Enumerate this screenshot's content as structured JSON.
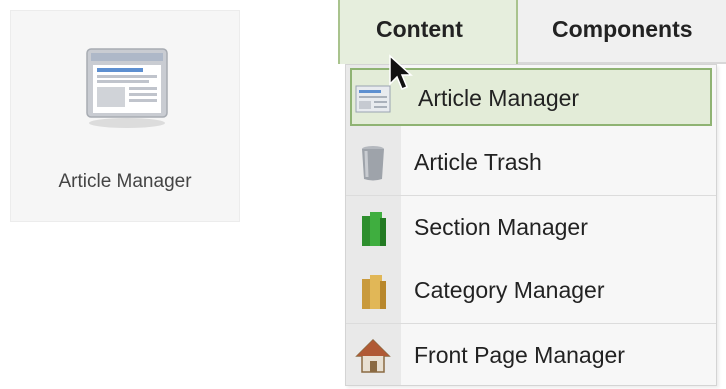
{
  "quick_icon": {
    "label": "Article Manager",
    "icon": "article-manager-icon"
  },
  "menubar": {
    "tabs": [
      {
        "label": "Content",
        "active": true
      },
      {
        "label": "Components",
        "active": false
      }
    ]
  },
  "dropdown": {
    "items": [
      {
        "label": "Article Manager",
        "icon": "article-manager-icon",
        "highlighted": true
      },
      {
        "label": "Article Trash",
        "icon": "trash-can-icon"
      },
      {
        "label": "Section Manager",
        "icon": "section-books-icon"
      },
      {
        "label": "Category Manager",
        "icon": "category-books-icon"
      },
      {
        "label": "Front Page Manager",
        "icon": "home-icon"
      }
    ]
  },
  "colors": {
    "active_tab_bg": "#e6eedd",
    "highlight_border": "#8fb373",
    "menu_bg": "#f7f7f7",
    "icon_gutter": "#e9e9e9"
  }
}
